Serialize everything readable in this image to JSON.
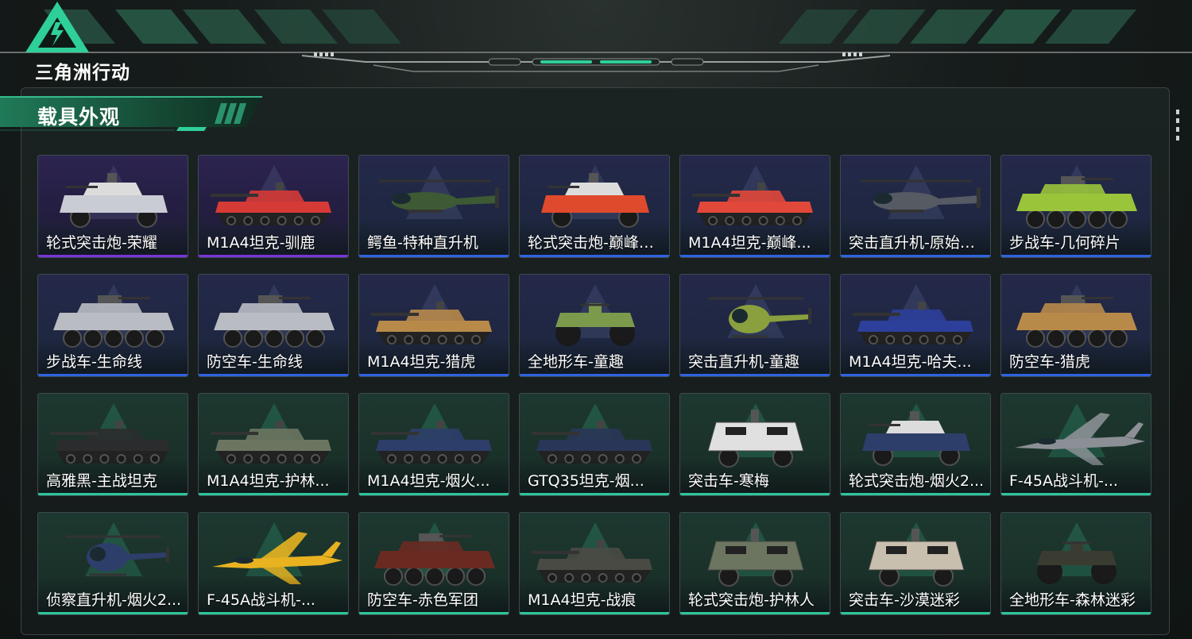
{
  "header": {
    "logo_text": "三角洲行动",
    "section_title": "载具外观"
  },
  "colors": {
    "accent": "#2fcf9a",
    "rarity_purple": "#7a34d8",
    "rarity_blue": "#2f63e0",
    "rarity_green": "#2ec59a"
  },
  "items": [
    {
      "label": "轮式突击炮-荣耀",
      "rarity": "purple",
      "icon": "wheeled-assault-gun-icon",
      "tint": "#c9ccd4"
    },
    {
      "label": "M1A4坦克-驯鹿",
      "rarity": "purple",
      "icon": "tank-icon",
      "tint": "#d63a36"
    },
    {
      "label": "鳄鱼-特种直升机",
      "rarity": "blue",
      "icon": "attack-helicopter-icon",
      "tint": "#3e5a34"
    },
    {
      "label": "轮式突击炮-巅峰竞...",
      "rarity": "blue",
      "icon": "wheeled-assault-gun-icon",
      "tint": "#e04a2c"
    },
    {
      "label": "M1A4坦克-巅峰...",
      "rarity": "blue",
      "icon": "tank-icon",
      "tint": "#e2483a"
    },
    {
      "label": "突击直升机-原始伪...",
      "rarity": "blue",
      "icon": "attack-helicopter-icon",
      "tint": "#555a63"
    },
    {
      "label": "步战车-几何碎片",
      "rarity": "blue",
      "icon": "ifv-icon",
      "tint": "#9ac43a"
    },
    {
      "label": "步战车-生命线",
      "rarity": "blue",
      "icon": "ifv-icon",
      "tint": "#b9bcc2"
    },
    {
      "label": "防空车-生命线",
      "rarity": "blue",
      "icon": "ifv-icon",
      "tint": "#b9bcc2"
    },
    {
      "label": "M1A4坦克-猎虎",
      "rarity": "blue",
      "icon": "tank-icon",
      "tint": "#b88a4a"
    },
    {
      "label": "全地形车-童趣",
      "rarity": "blue",
      "icon": "atv-icon",
      "tint": "#7b9a4c"
    },
    {
      "label": "突击直升机-童趣",
      "rarity": "blue",
      "icon": "light-helicopter-icon",
      "tint": "#8aa03e"
    },
    {
      "label": "M1A4坦克-哈夫...",
      "rarity": "blue",
      "icon": "tank-icon",
      "tint": "#2c3f9a"
    },
    {
      "label": "防空车-猎虎",
      "rarity": "blue",
      "icon": "ifv-icon",
      "tint": "#b88a4a"
    },
    {
      "label": "高雅黑-主战坦克",
      "rarity": "green",
      "icon": "tank-icon",
      "tint": "#2a2c2e"
    },
    {
      "label": "M1A4坦克-护林...",
      "rarity": "green",
      "icon": "tank-icon",
      "tint": "#6c7560"
    },
    {
      "label": "M1A4坦克-烟火...",
      "rarity": "green",
      "icon": "tank-icon",
      "tint": "#2e3e6a"
    },
    {
      "label": "GTQ35坦克-烟...",
      "rarity": "green",
      "icon": "tank-icon",
      "tint": "#2a3658"
    },
    {
      "label": "突击车-寒梅",
      "rarity": "green",
      "icon": "armored-car-icon",
      "tint": "#e0e0e0"
    },
    {
      "label": "轮式突击炮-烟火2...",
      "rarity": "green",
      "icon": "wheeled-assault-gun-icon",
      "tint": "#2e3e6a"
    },
    {
      "label": "F-45A战斗机-...",
      "rarity": "green",
      "icon": "fighter-jet-icon",
      "tint": "#8c9096"
    },
    {
      "label": "侦察直升机-烟火2...",
      "rarity": "green",
      "icon": "light-helicopter-icon",
      "tint": "#2e3e6a"
    },
    {
      "label": "F-45A战斗机-...",
      "rarity": "green",
      "icon": "fighter-jet-icon",
      "tint": "#e8b220"
    },
    {
      "label": "防空车-赤色军团",
      "rarity": "green",
      "icon": "ifv-icon",
      "tint": "#6a2a22"
    },
    {
      "label": "M1A4坦克-战痕",
      "rarity": "green",
      "icon": "tank-icon",
      "tint": "#4a4a44"
    },
    {
      "label": "轮式突击炮-护林人",
      "rarity": "green",
      "icon": "armored-car-icon",
      "tint": "#6c7560"
    },
    {
      "label": "突击车-沙漠迷彩",
      "rarity": "green",
      "icon": "armored-car-icon",
      "tint": "#c8bfae"
    },
    {
      "label": "全地形车-森林迷彩",
      "rarity": "green",
      "icon": "atv-icon",
      "tint": "#3a3c32"
    }
  ]
}
